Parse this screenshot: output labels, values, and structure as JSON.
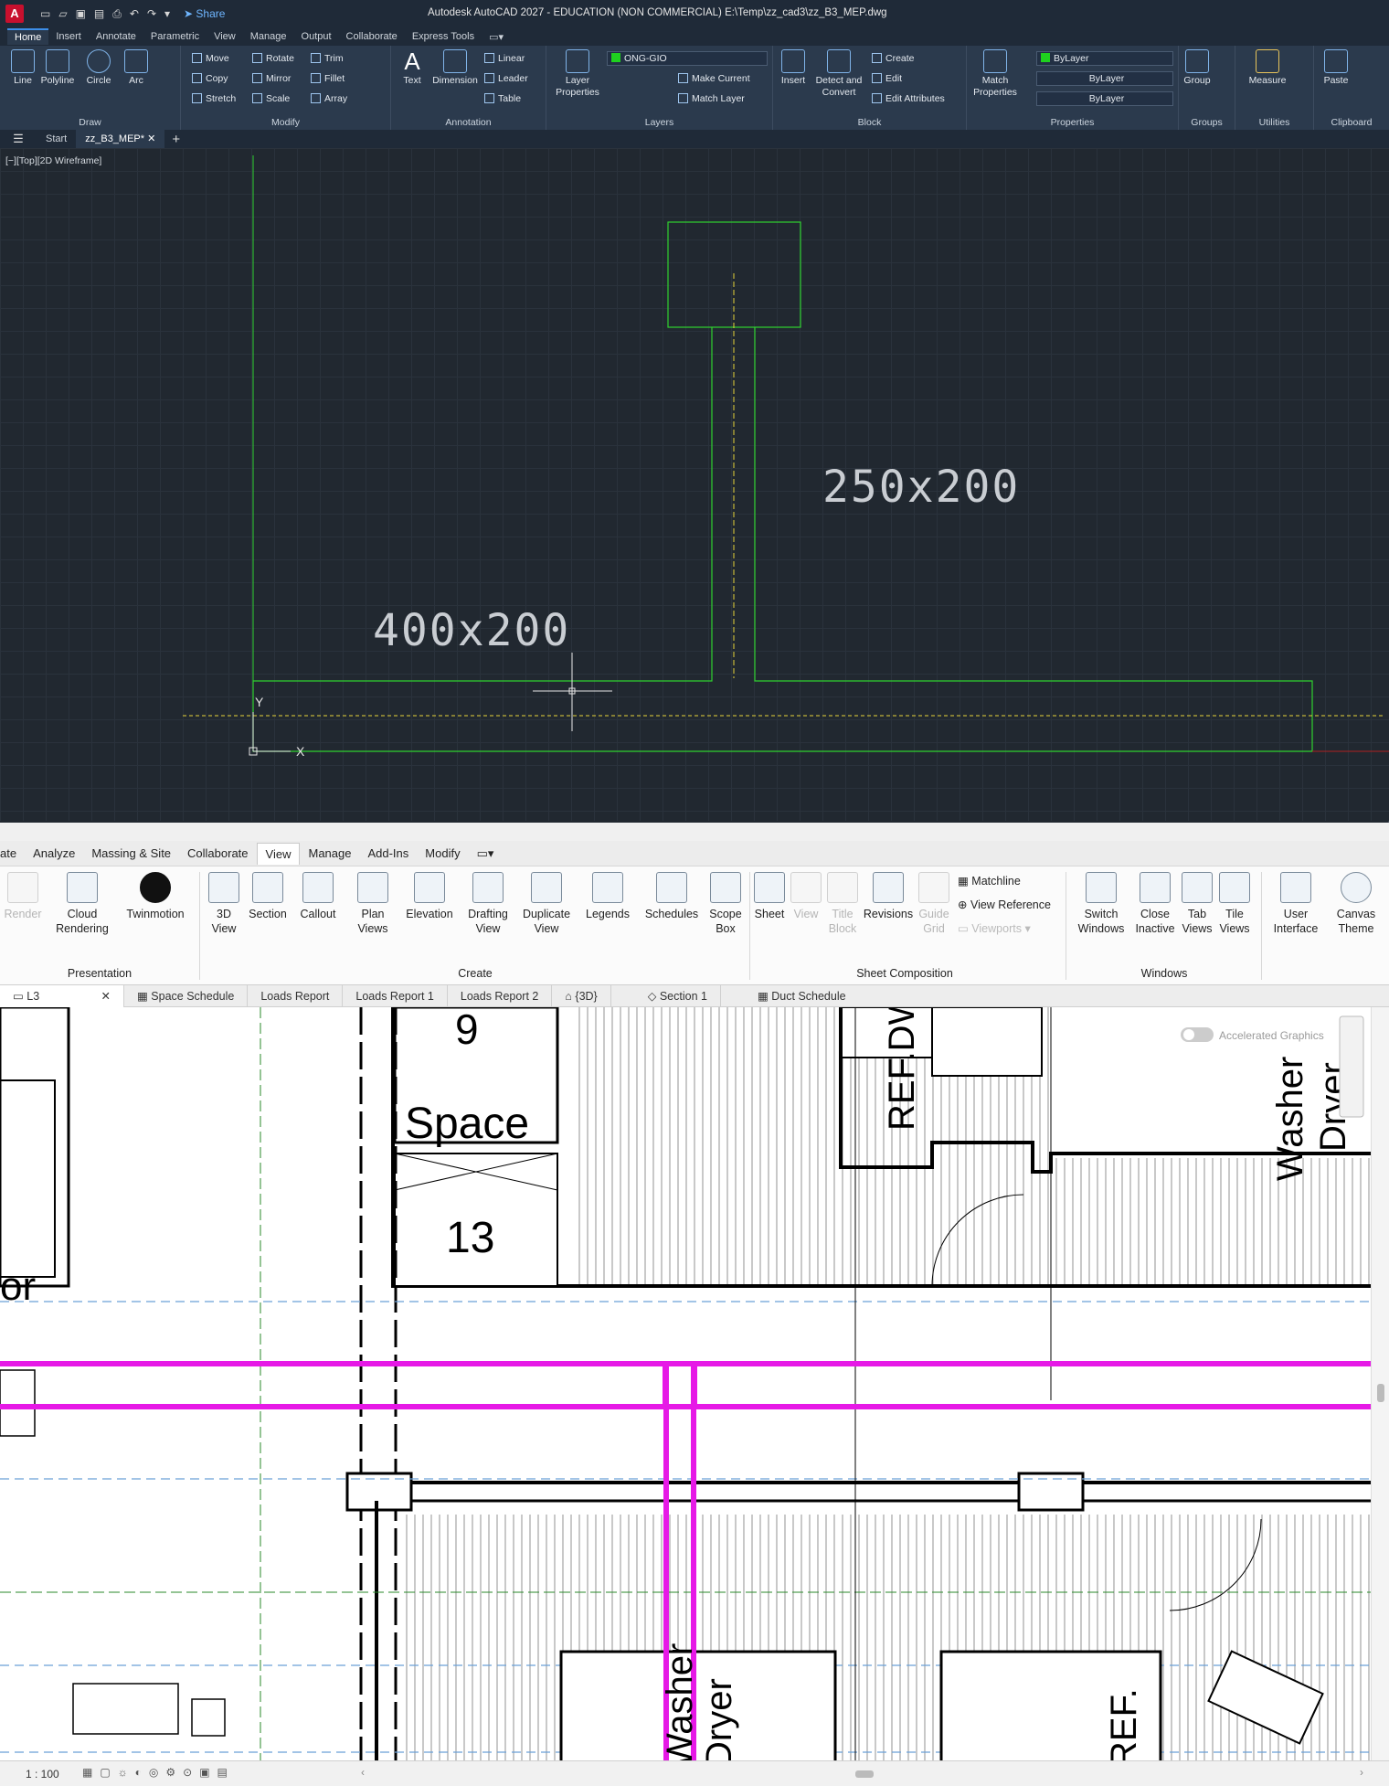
{
  "autocad": {
    "title": "Autodesk AutoCAD 2027 - EDUCATION (NON COMMERCIAL)    E:\\Temp\\zz_cad3\\zz_B3_MEP.dwg",
    "share": "Share",
    "logo": "A",
    "menu_tabs": [
      "Home",
      "Insert",
      "Annotate",
      "Parametric",
      "View",
      "Manage",
      "Output",
      "Collaborate",
      "Express Tools"
    ],
    "active_tab": "Home",
    "ribbon": {
      "draw": {
        "title": "Draw",
        "line": "Line",
        "polyline": "Polyline",
        "circle": "Circle",
        "arc": "Arc"
      },
      "modify": {
        "title": "Modify",
        "move": "Move",
        "rotate": "Rotate",
        "trim": "Trim",
        "copy": "Copy",
        "mirror": "Mirror",
        "fillet": "Fillet",
        "stretch": "Stretch",
        "scale": "Scale",
        "array": "Array"
      },
      "annotation": {
        "title": "Annotation",
        "text": "Text",
        "dimension": "Dimension",
        "linear": "Linear",
        "leader": "Leader",
        "table": "Table"
      },
      "layers": {
        "title": "Layers",
        "layer_properties": "Layer Properties",
        "current_layer": "ONG-GIO",
        "make_current": "Make Current",
        "match_layer": "Match Layer"
      },
      "block": {
        "title": "Block",
        "insert": "Insert",
        "detect": "Detect and Convert",
        "create": "Create",
        "edit": "Edit",
        "edit_attributes": "Edit Attributes"
      },
      "properties": {
        "title": "Properties",
        "match": "Match Properties",
        "color": "ByLayer",
        "linetype": "ByLayer",
        "lineweight": "ByLayer"
      },
      "groups": {
        "title": "Groups",
        "group": "Group"
      },
      "utilities": {
        "title": "Utilities",
        "measure": "Measure"
      },
      "clipboard": {
        "title": "Clipboard",
        "paste": "Paste"
      }
    },
    "file_tabs": [
      "Start",
      "zz_B3_MEP*"
    ],
    "viewport_label": "[−][Top][2D Wireframe]",
    "dim_text_1": "250x200",
    "dim_text_2": "400x200",
    "ucs_x": "X",
    "ucs_y": "Y",
    "colors": {
      "geometry": "#2fd12f",
      "centerline": "#e6d43a",
      "text": "#c9cdd2"
    }
  },
  "revit": {
    "menu_tabs": [
      "ate",
      "Analyze",
      "Massing & Site",
      "Collaborate",
      "View",
      "Manage",
      "Add-Ins",
      "Modify"
    ],
    "active_tab": "View",
    "ribbon": {
      "presentation": {
        "title": "Presentation",
        "render": "Render",
        "cloud": "Cloud Rendering",
        "twinmotion": "Twinmotion"
      },
      "create": {
        "title": "Create",
        "view3d": "3D View",
        "section": "Section",
        "callout": "Callout",
        "plan": "Plan Views",
        "elevation": "Elevation",
        "drafting": "Drafting View",
        "duplicate": "Duplicate View",
        "legends": "Legends",
        "schedules": "Schedules",
        "scope": "Scope Box"
      },
      "sheet": {
        "title": "Sheet Composition",
        "sheet": "Sheet",
        "view": "View",
        "titleblock": "Title Block",
        "revisions": "Revisions",
        "guide": "Guide Grid",
        "matchline": "Matchline",
        "viewref": "View  Reference",
        "viewports": "Viewports"
      },
      "windows": {
        "title": "Windows",
        "switch": "Switch Windows",
        "close": "Close Inactive",
        "tab": "Tab Views",
        "tile": "Tile Views"
      },
      "ui": {
        "user_interface": "User Interface",
        "canvas_theme": "Canvas Theme"
      }
    },
    "view_tabs": [
      "L3",
      "Space Schedule",
      "Loads Report",
      "Loads Report 1",
      "Loads Report 2",
      "{3D}",
      "Section 1",
      "Duct Schedule"
    ],
    "active_view": "L3",
    "canvas": {
      "space_label": "Space",
      "space_num": "9",
      "space_num2": "13",
      "text_or": "or",
      "washer": "Washer",
      "dryer": "Dryer",
      "ref": "REF.DW",
      "ref2": "REF.",
      "washer2": "Washer",
      "dryer2": "Dryer",
      "accel": "Accelerated Graphics"
    },
    "scale": "1 : 100",
    "colors": {
      "duct": "#e619e6",
      "grid": "#6aa0d8"
    }
  }
}
